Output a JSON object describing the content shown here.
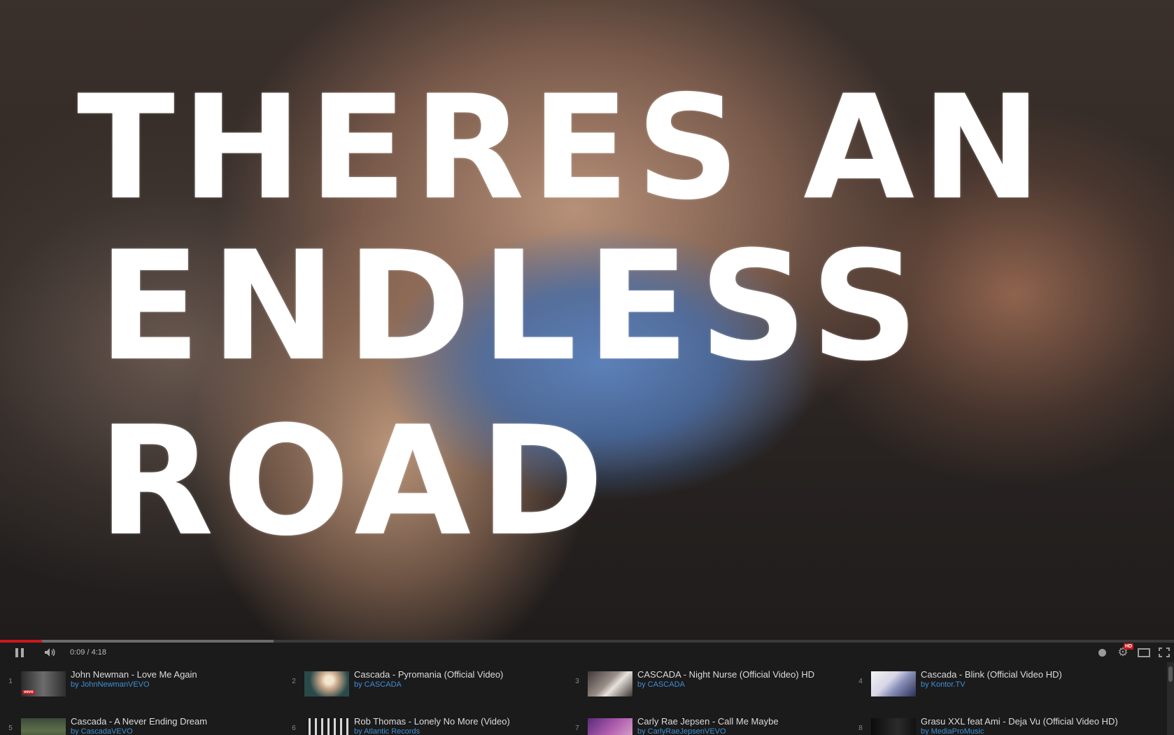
{
  "video": {
    "overlay_lines": [
      "THERES AN",
      "ENDLESS",
      "ROAD"
    ]
  },
  "player": {
    "progress": {
      "played_fraction": 0.036,
      "loaded_fraction": 0.233
    },
    "time_display": "0:09 / 4:18",
    "hd_badge": "HD",
    "colors": {
      "accent": "#cc181e",
      "channel_link": "#3e8ed7"
    },
    "icons": [
      "pause-icon",
      "volume-icon",
      "annotations-icon",
      "settings-gear-icon",
      "theater-mode-icon",
      "fullscreen-icon"
    ]
  },
  "playlist": {
    "items": [
      {
        "index": "1",
        "title": "John Newman - Love Me Again",
        "channel": "by JohnNewmanVEVO",
        "badge": "vevo"
      },
      {
        "index": "2",
        "title": "Cascada - Pyromania (Official Video)",
        "channel": "by CASCADA"
      },
      {
        "index": "3",
        "title": "CASCADA - Night Nurse (Official Video) HD",
        "channel": "by CASCADA"
      },
      {
        "index": "4",
        "title": "Cascada - Blink (Official Video HD)",
        "channel": "by Kontor.TV"
      },
      {
        "index": "5",
        "title": "Cascada - A Never Ending Dream",
        "channel": "by CascadaVEVO"
      },
      {
        "index": "6",
        "title": "Rob Thomas - Lonely No More (Video)",
        "channel": "by Atlantic Records"
      },
      {
        "index": "7",
        "title": "Carly Rae Jepsen - Call Me Maybe",
        "channel": "by CarlyRaeJepsenVEVO"
      },
      {
        "index": "8",
        "title": "Grasu XXL feat Ami - Deja Vu (Official Video HD)",
        "channel": "by MediaProMusic"
      }
    ]
  }
}
